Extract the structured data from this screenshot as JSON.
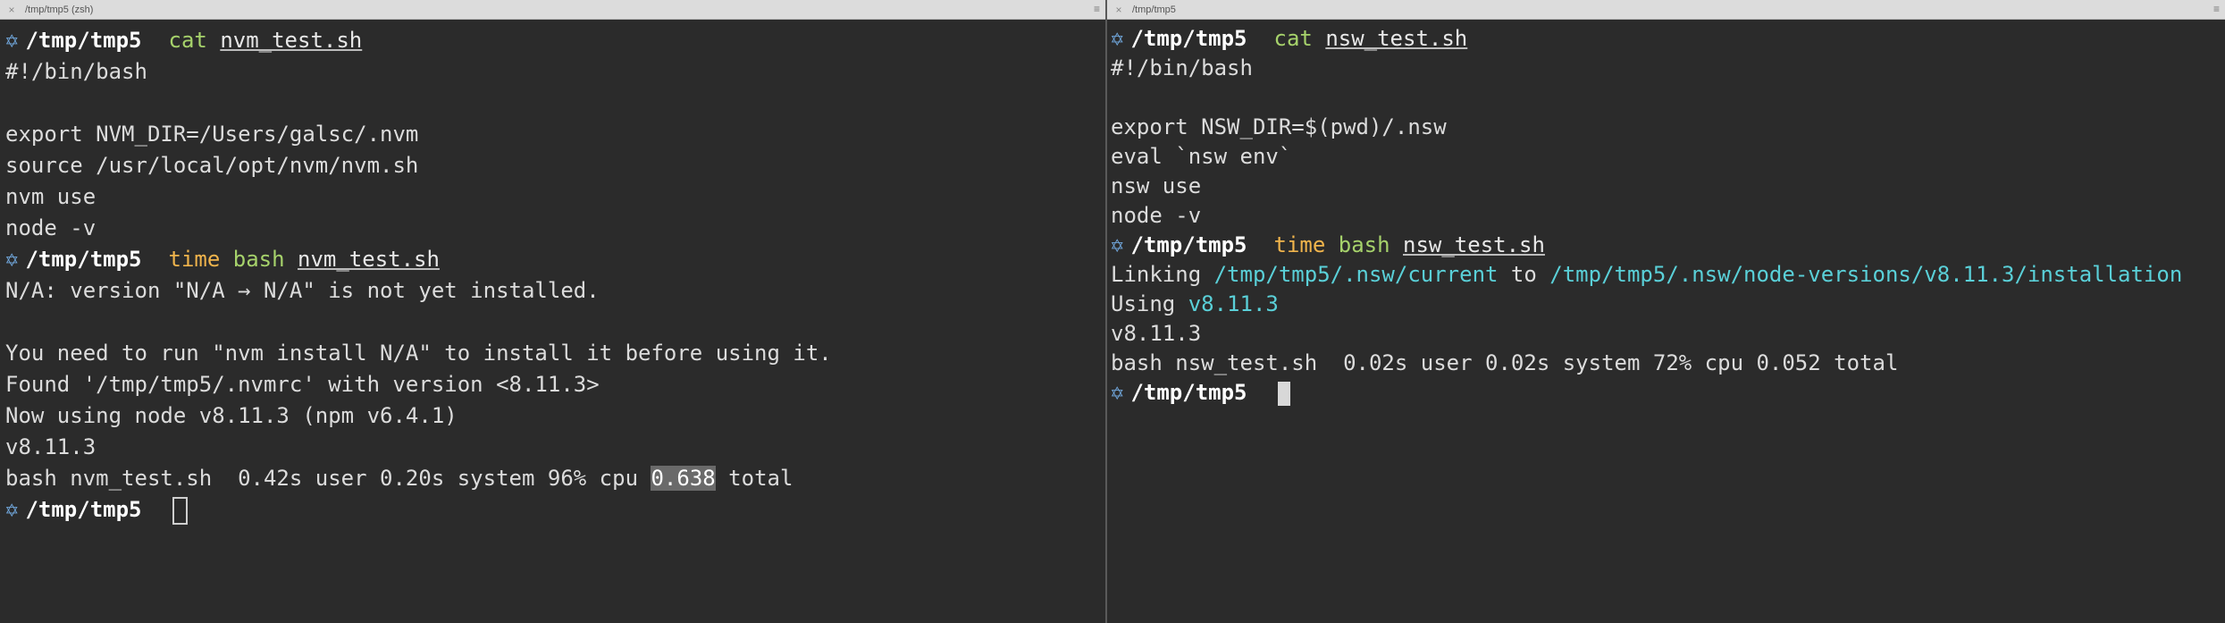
{
  "left": {
    "tab_title": "/tmp/tmp5 (zsh)",
    "tab_close": "×",
    "tab_menu": "≡",
    "prompt_icon": "✡",
    "prompt_dir": "/tmp/tmp5",
    "cmd1": {
      "name": "cat",
      "arg": "nvm_test.sh"
    },
    "script_lines": [
      "#!/bin/bash",
      "",
      "export NVM_DIR=/Users/galsc/.nvm",
      "source /usr/local/opt/nvm/nvm.sh",
      "nvm use",
      "node -v"
    ],
    "cmd2": {
      "time": "time",
      "name": "bash",
      "arg": "nvm_test.sh"
    },
    "output_lines": [
      "N/A: version \"N/A → N/A\" is not yet installed.",
      "",
      "You need to run \"nvm install N/A\" to install it before using it.",
      "Found '/tmp/tmp5/.nvmrc' with version <8.11.3>",
      "Now using node v8.11.3 (npm v6.4.1)",
      "v8.11.3"
    ],
    "timing": {
      "before": "bash nvm_test.sh  0.42s user 0.20s system 96% cpu ",
      "highlight": "0.638",
      "after": " total"
    }
  },
  "right": {
    "tab_title": "/tmp/tmp5",
    "tab_close": "×",
    "tab_menu": "≡",
    "prompt_icon": "✡",
    "prompt_dir": "/tmp/tmp5",
    "cmd1": {
      "name": "cat",
      "arg": "nsw_test.sh"
    },
    "script_lines": [
      "#!/bin/bash",
      "",
      "export NSW_DIR=$(pwd)/.nsw",
      "eval `nsw env`",
      "nsw use",
      "node -v"
    ],
    "cmd2": {
      "time": "time",
      "name": "bash",
      "arg": "nsw_test.sh"
    },
    "linking": {
      "word": "Linking ",
      "src": "/tmp/tmp5/.nsw/current",
      "to": " to ",
      "dst": "/tmp/tmp5/.nsw/node-versions/v8.11.3/installation"
    },
    "using": {
      "word": "Using ",
      "version": "v8.11.3"
    },
    "version_line": "v8.11.3",
    "timing": "bash nsw_test.sh  0.02s user 0.02s system 72% cpu 0.052 total"
  },
  "colors": {
    "background": "#2b2b2b",
    "prompt_icon": "#6fa4d8",
    "command": "#a6d26b",
    "time_keyword": "#f0b44c",
    "path_highlight": "#5ad0d8"
  }
}
